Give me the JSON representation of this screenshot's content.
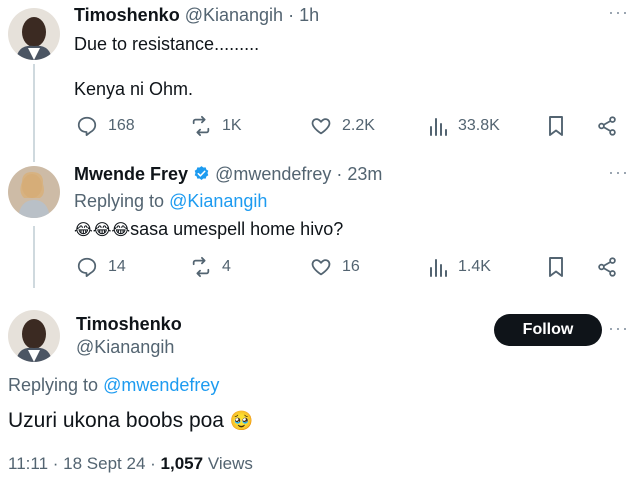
{
  "tweet1": {
    "name": "Timoshenko",
    "handle": "@Kianangih",
    "time": "· 1h",
    "line1": "Due to resistance.........",
    "line2": "Kenya ni Ohm.",
    "replies": "168",
    "reposts": "1K",
    "likes": "2.2K",
    "views": "33.8K"
  },
  "tweet2": {
    "name": "Mwende Frey",
    "handle": "@mwendefrey",
    "time": "· 23m",
    "replying_prefix": "Replying to",
    "replying_to": "@Kianangih",
    "text": "sasa umespell home hivo?",
    "emoji": "😂😂😂",
    "replies": "14",
    "reposts": "4",
    "likes": "16",
    "views": "1.4K"
  },
  "tweet3": {
    "name": "Timoshenko",
    "handle": "@Kianangih",
    "follow_label": "Follow",
    "replying_prefix": "Replying to",
    "replying_to": "@mwendefrey",
    "text": "Uzuri ukona boobs poa",
    "emoji": "🥹",
    "time": "11:11",
    "date": "18 Sept 24",
    "views_count": "1,057",
    "views_label": "Views"
  },
  "icons": {
    "reply": "reply-icon",
    "repost": "repost-icon",
    "like": "heart-icon",
    "views": "views-icon",
    "bookmark": "bookmark-icon",
    "share": "share-icon",
    "verified": "verified-badge-icon",
    "more": "more-icon"
  },
  "colors": {
    "text": "#0f1419",
    "muted": "#536471",
    "link": "#1d9bf0",
    "verified": "#1d9bf0",
    "button_bg": "#0f1419"
  }
}
